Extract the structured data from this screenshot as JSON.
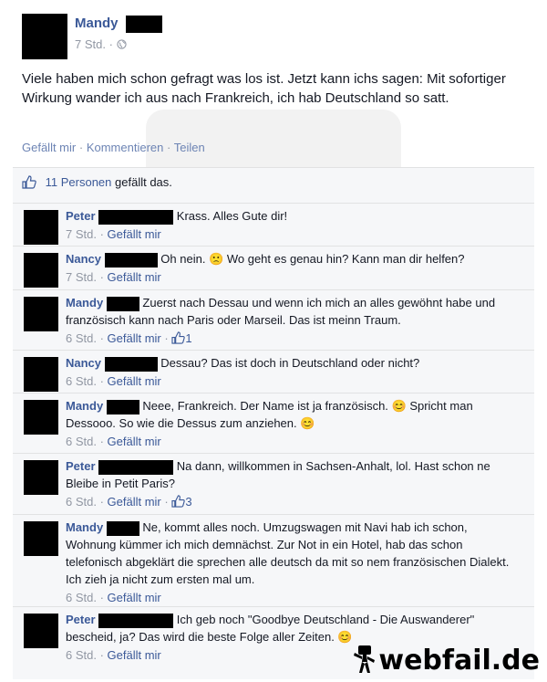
{
  "post": {
    "author": "Mandy",
    "time": "7 Std.",
    "privacy_icon": "globe-icon",
    "text": "Viele haben mich schon gefragt was los ist. Jetzt kann ichs sagen: Mit sofortiger Wirkung wander ich aus nach Frankreich, ich hab Deutschland so satt.",
    "actions": {
      "like": "Gefällt mir",
      "comment": "Kommentieren",
      "share": "Teilen",
      "separator": "·"
    }
  },
  "likes": {
    "count_text": "11 Personen",
    "suffix": "gefällt das."
  },
  "comments": [
    {
      "name": "Peter",
      "text": "Krass. Alles Gute dir!",
      "time": "7 Std.",
      "like": "Gefällt mir",
      "likes": ""
    },
    {
      "name": "Nancy",
      "text": "Oh nein. 🙁 Wo geht es genau hin? Kann man dir helfen?",
      "time": "7 Std.",
      "like": "Gefällt mir",
      "likes": ""
    },
    {
      "name": "Mandy",
      "text": "Zuerst nach Dessau und wenn ich mich an alles gewöhnt habe und französisch kann nach Paris oder Marseil. Das ist meinn Traum.",
      "time": "6 Std.",
      "like": "Gefällt mir",
      "likes": "1"
    },
    {
      "name": "Nancy",
      "text": "Dessau? Das ist doch in Deutschland oder nicht?",
      "time": "6 Std.",
      "like": "Gefällt mir",
      "likes": ""
    },
    {
      "name": "Mandy",
      "text": "Neee, Frankreich. Der Name ist ja französisch. 😊 Spricht man Dessooo. So wie die Dessus zum anziehen. 😊",
      "time": "6 Std.",
      "like": "Gefällt mir",
      "likes": ""
    },
    {
      "name": "Peter",
      "text": "Na dann, willkommen in Sachsen-Anhalt, lol. Hast schon ne Bleibe in Petit Paris?",
      "time": "6 Std.",
      "like": "Gefällt mir",
      "likes": "3"
    },
    {
      "name": "Mandy",
      "text": "Ne, kommt alles noch. Umzugswagen mit Navi hab ich schon, Wohnung kümmer ich mich demnächst. Zur Not in ein Hotel, hab das schon telefonisch abgeklärt die sprechen alle deutsch da mit so nem französischen Dialekt. Ich zieh ja nicht zum ersten mal um.",
      "time": "6 Std.",
      "like": "Gefällt mir",
      "likes": ""
    },
    {
      "name": "Peter",
      "text": "Ich geb noch \"Goodbye Deutschland - Die Auswanderer\" bescheid, ja? Das wird die beste Folge aller Zeiten. 😊",
      "time": "6 Std.",
      "like": "Gefällt mir",
      "likes": ""
    }
  ],
  "watermark": {
    "logo_text": "webfail.de"
  },
  "colors": {
    "link": "#3b5998",
    "meta": "#9197a3",
    "panel": "#f6f7f9"
  }
}
